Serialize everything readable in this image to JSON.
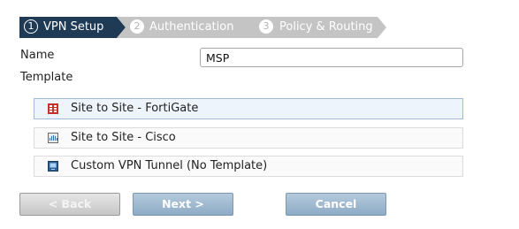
{
  "wizard": {
    "steps": [
      {
        "number": "1",
        "label": "VPN Setup",
        "state": "active"
      },
      {
        "number": "2",
        "label": "Authentication",
        "state": "inactive"
      },
      {
        "number": "3",
        "label": "Policy & Routing",
        "state": "inactive"
      }
    ],
    "colors": {
      "active": "#1f3a55",
      "inactive": "#c4c4c4"
    }
  },
  "form": {
    "name_label": "Name",
    "name_value": "MSP",
    "template_label": "Template",
    "templates": [
      {
        "label": "Site to Site - FortiGate",
        "icon": "fortigate-icon",
        "selected": true
      },
      {
        "label": "Site to Site - Cisco",
        "icon": "cisco-icon",
        "selected": false
      },
      {
        "label": "Custom VPN Tunnel (No Template)",
        "icon": "custom-tunnel-icon",
        "selected": false
      }
    ]
  },
  "buttons": {
    "back": "< Back",
    "next": "Next >",
    "cancel": "Cancel"
  }
}
